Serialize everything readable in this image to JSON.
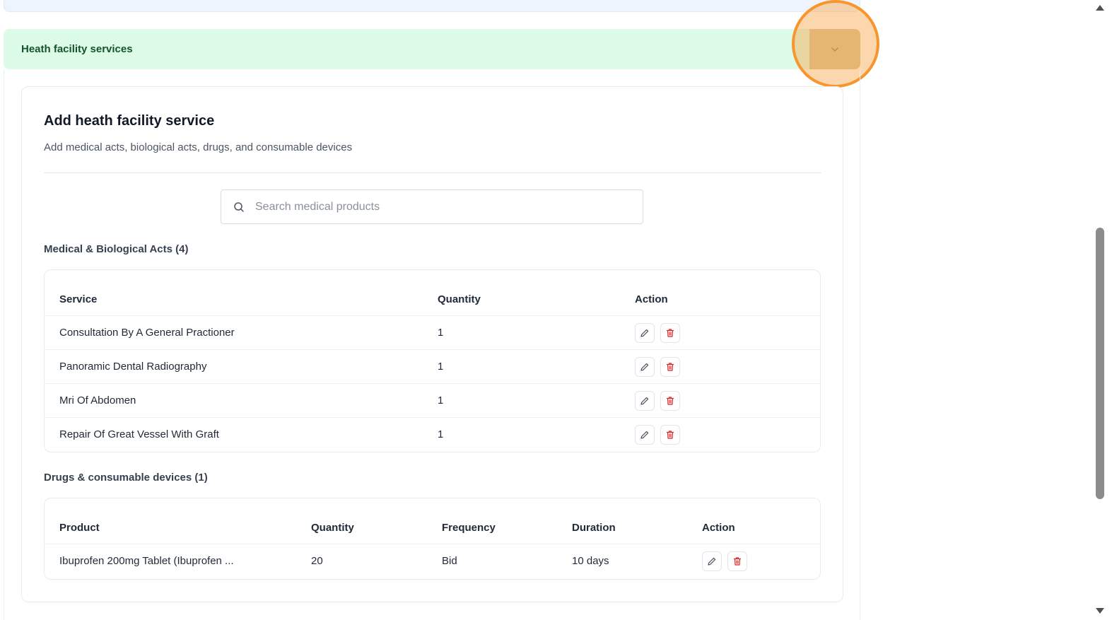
{
  "accordion": {
    "title": "Heath facility services"
  },
  "card": {
    "title": "Add heath facility service",
    "subtitle": "Add medical acts, biological acts, drugs, and consumable devices"
  },
  "search": {
    "placeholder": "Search medical products"
  },
  "medical_acts": {
    "title": "Medical & Biological Acts (4)",
    "columns": [
      "Service",
      "Quantity",
      "Action"
    ],
    "rows": [
      {
        "service": "Consultation By A General Practioner",
        "quantity": "1"
      },
      {
        "service": "Panoramic Dental Radiography",
        "quantity": "1"
      },
      {
        "service": "Mri Of Abdomen",
        "quantity": "1"
      },
      {
        "service": "Repair Of Great Vessel With Graft",
        "quantity": "1"
      }
    ]
  },
  "drugs": {
    "title": "Drugs & consumable devices (1)",
    "columns": [
      "Product",
      "Quantity",
      "Frequency",
      "Duration",
      "Action"
    ],
    "rows": [
      {
        "product": "Ibuprofen 200mg Tablet (Ibuprofen ...",
        "quantity": "20",
        "frequency": "Bid",
        "duration": "10 days"
      }
    ]
  },
  "icons": {
    "edit": "pencil-icon",
    "delete": "trash-icon",
    "toggle": "chevron-down-icon",
    "search": "search-icon"
  },
  "colors": {
    "accordion_bg": "#dcfce7",
    "accordion_text": "#14532d",
    "delete_icon": "#dc2626",
    "click_highlight": "#f7952f"
  }
}
